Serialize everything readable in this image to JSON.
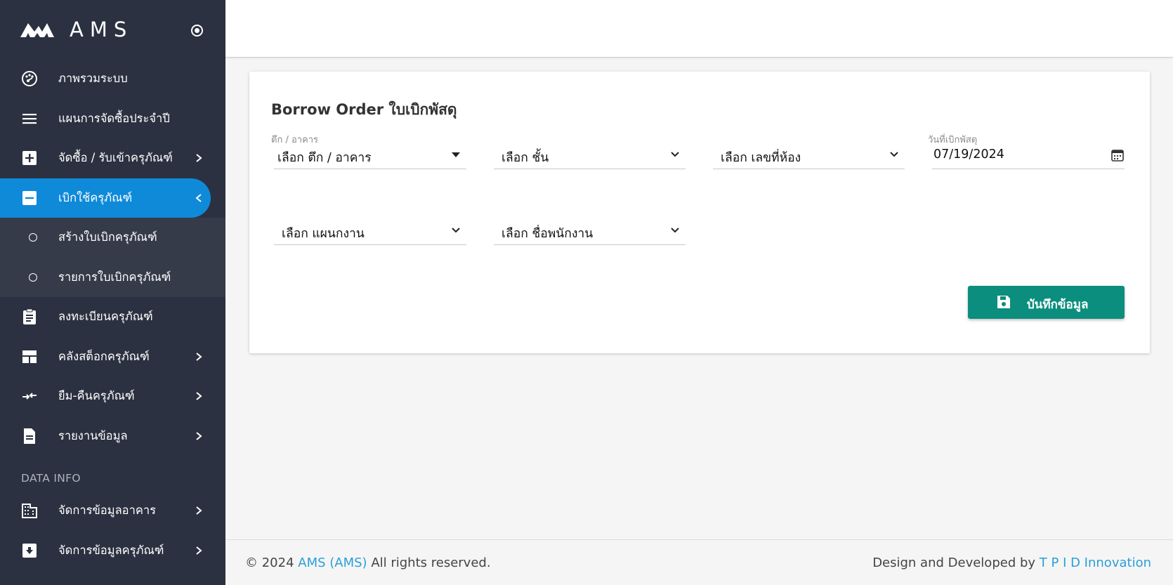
{
  "brand": {
    "name": "AMS"
  },
  "sidebar": {
    "items": [
      {
        "label": "ภาพรวมระบบ"
      },
      {
        "label": "แผนการจัดซื้อประจำปี"
      },
      {
        "label": "จัดซื้อ / รับเข้าครุภัณฑ์"
      },
      {
        "label": "เบิกใช้ครุภัณฑ์"
      },
      {
        "label": "สร้างใบเบิกครุภัณฑ์"
      },
      {
        "label": "รายการใบเบิกครุภัณฑ์"
      },
      {
        "label": "ลงทะเบียนครุภัณฑ์"
      },
      {
        "label": "คลังสต็อกครุภัณฑ์"
      },
      {
        "label": "ยืม-คืนครุภัณฑ์"
      },
      {
        "label": "รายงานข้อมูล"
      }
    ],
    "section_label": "DATA INFO",
    "data_items": [
      {
        "label": "จัดการข้อมูลอาคาร"
      },
      {
        "label": "จัดการข้อมูลครุภัณฑ์"
      }
    ]
  },
  "form": {
    "title": "Borrow Order ใบเบิกพัสดุ",
    "building_label": "ตึก / อาคาร",
    "building_value": "เลือก ตึก / อาคาร",
    "floor_value": "เลือก ชั้น",
    "room_value": "เลือก เลขที่ห้อง",
    "date_label": "วันที่เบิกพัสดุ",
    "date_value": "07/19/2024",
    "department_value": "เลือก แผนกงาน",
    "employee_value": "เลือก ชื่อพนักงาน",
    "save_label": "บันทึกข้อมูล"
  },
  "footer": {
    "copyright_prefix": "© 2024",
    "copyright_link": "AMS (AMS)",
    "copyright_suffix": "All rights reserved.",
    "credit_prefix": "Design and Developed by",
    "credit_link": "T P I D Innovation"
  },
  "colors": {
    "sidebar_bg": "#2b3140",
    "active_item": "#0f8ad9",
    "save_button": "#0b8e7e",
    "link": "#2a9fd8"
  }
}
